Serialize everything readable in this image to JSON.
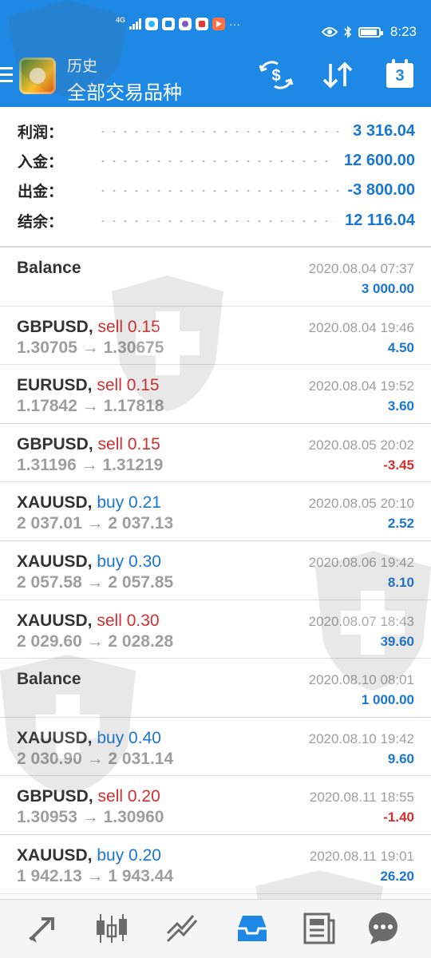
{
  "status_bar": {
    "network": "4G",
    "time": "8:23",
    "notif_more": "···"
  },
  "app_bar": {
    "title": "历史",
    "subtitle": "全部交易品种",
    "calendar_day": "3",
    "icons": [
      "menu-icon",
      "app-logo",
      "currency-exchange-icon",
      "sort-icon",
      "calendar-icon"
    ]
  },
  "summary": {
    "rows": [
      {
        "label": "利润：",
        "value": "3 316.04"
      },
      {
        "label": "入金：",
        "value": "12 600.00"
      },
      {
        "label": "出金：",
        "value": "-3 800.00"
      },
      {
        "label": "结余：",
        "value": "12 116.04"
      }
    ]
  },
  "deals": [
    {
      "symbol": "Balance",
      "side": "",
      "side_label": "",
      "prices": "",
      "time": "2020.08.04 07:37",
      "profit": "3 000.00",
      "profit_sign": "pos"
    },
    {
      "symbol": "GBPUSD,",
      "side": "sell",
      "side_label": "sell 0.15",
      "prices": "1.30705 → 1.30675",
      "time": "2020.08.04 19:46",
      "profit": "4.50",
      "profit_sign": "pos"
    },
    {
      "symbol": "EURUSD,",
      "side": "sell",
      "side_label": "sell 0.15",
      "prices": "1.17842 → 1.17818",
      "time": "2020.08.04 19:52",
      "profit": "3.60",
      "profit_sign": "pos"
    },
    {
      "symbol": "GBPUSD,",
      "side": "sell",
      "side_label": "sell 0.15",
      "prices": "1.31196 → 1.31219",
      "time": "2020.08.05 20:02",
      "profit": "-3.45",
      "profit_sign": "neg"
    },
    {
      "symbol": "XAUUSD,",
      "side": "buy",
      "side_label": "buy 0.21",
      "prices": "2 037.01 → 2 037.13",
      "time": "2020.08.05 20:10",
      "profit": "2.52",
      "profit_sign": "pos"
    },
    {
      "symbol": "XAUUSD,",
      "side": "buy",
      "side_label": "buy 0.30",
      "prices": "2 057.58 → 2 057.85",
      "time": "2020.08.06 19:42",
      "profit": "8.10",
      "profit_sign": "pos"
    },
    {
      "symbol": "XAUUSD,",
      "side": "sell",
      "side_label": "sell 0.30",
      "prices": "2 029.60 → 2 028.28",
      "time": "2020.08.07 18:43",
      "profit": "39.60",
      "profit_sign": "pos"
    },
    {
      "symbol": "Balance",
      "side": "",
      "side_label": "",
      "prices": "",
      "time": "2020.08.10 08:01",
      "profit": "1 000.00",
      "profit_sign": "pos"
    },
    {
      "symbol": "XAUUSD,",
      "side": "buy",
      "side_label": "buy 0.40",
      "prices": "2 030.90 → 2 031.14",
      "time": "2020.08.10 19:42",
      "profit": "9.60",
      "profit_sign": "pos"
    },
    {
      "symbol": "GBPUSD,",
      "side": "sell",
      "side_label": "sell 0.20",
      "prices": "1.30953 → 1.30960",
      "time": "2020.08.11 18:55",
      "profit": "-1.40",
      "profit_sign": "neg"
    },
    {
      "symbol": "XAUUSD,",
      "side": "buy",
      "side_label": "buy 0.20",
      "prices": "1 942.13 → 1 943.44",
      "time": "2020.08.11 19:01",
      "profit": "26.20",
      "profit_sign": "pos"
    }
  ],
  "bottom_nav": {
    "items": [
      "quotes-icon",
      "chart-icon",
      "trade-icon",
      "history-icon",
      "news-icon",
      "chat-icon"
    ],
    "active": "history-icon"
  },
  "colors": {
    "primary": "#1e88e5",
    "profit_positive": "#1976d2",
    "profit_negative": "#d32f2f",
    "sell": "#d32f2f",
    "buy": "#1976d2"
  }
}
